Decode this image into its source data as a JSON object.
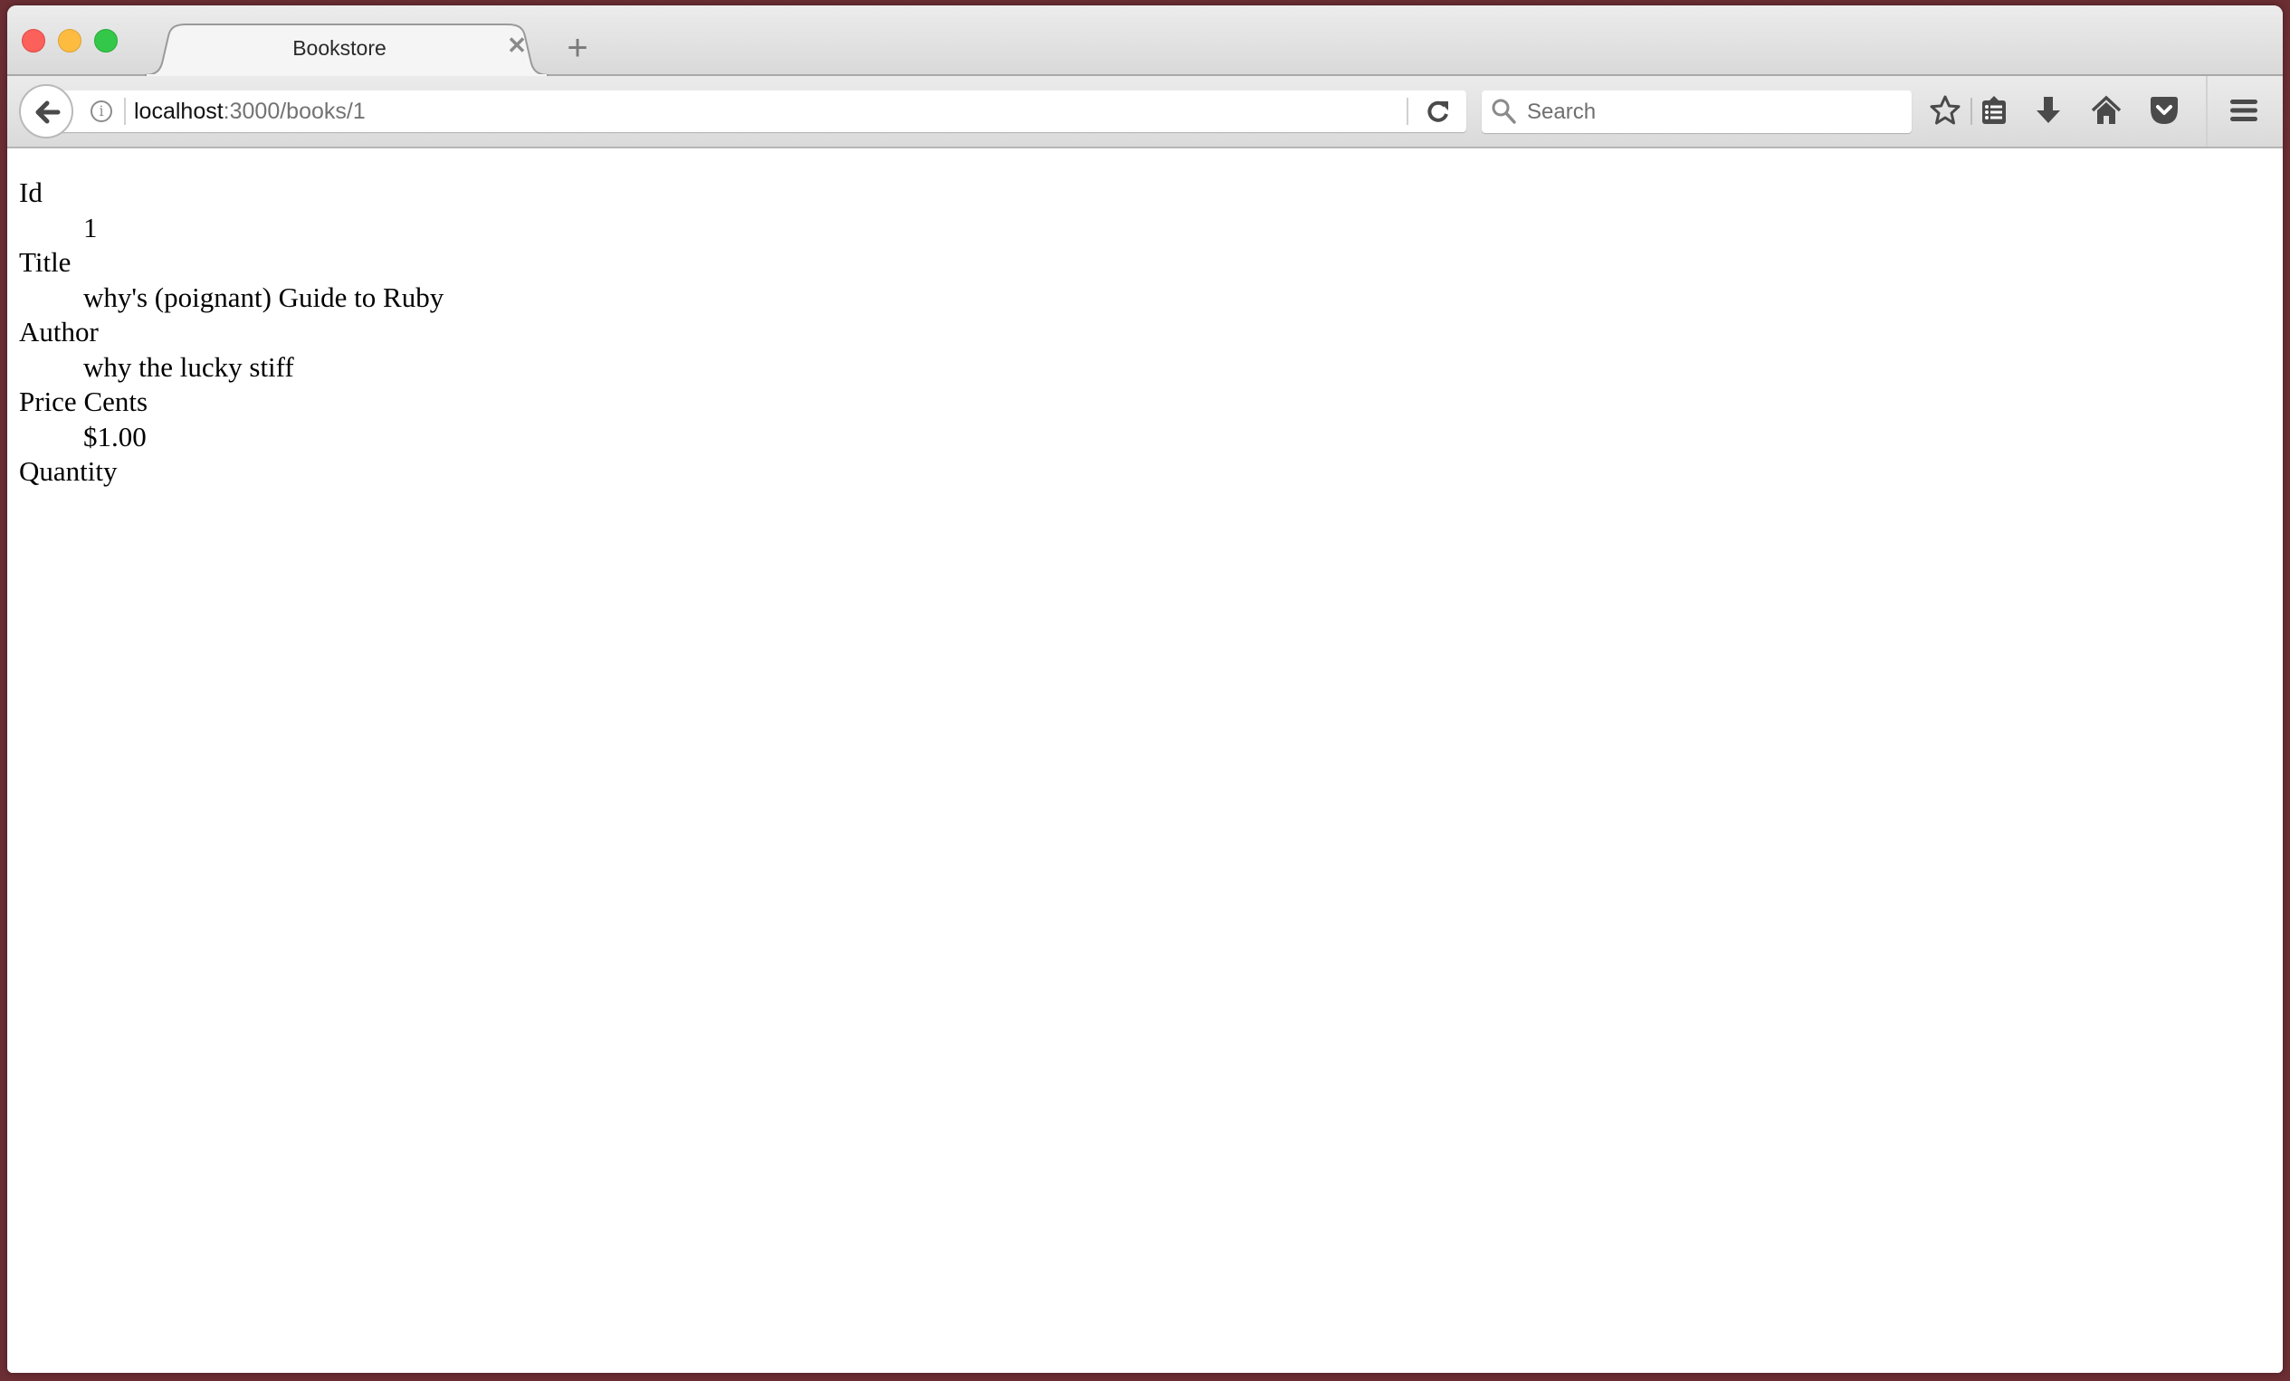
{
  "window": {
    "controls": [
      "close",
      "minimize",
      "zoom"
    ]
  },
  "tabs": [
    {
      "title": "Bookstore",
      "active": true,
      "close_glyph": "✕"
    }
  ],
  "new_tab_glyph": "+",
  "navbar": {
    "url_host": "localhost",
    "url_path": ":3000/books/1",
    "search_placeholder": "Search",
    "icons": [
      "back-icon",
      "info-icon",
      "reload-icon",
      "search-icon",
      "bookmark-star-icon",
      "reading-list-icon",
      "download-icon",
      "home-icon",
      "pocket-icon",
      "menu-icon"
    ]
  },
  "book": {
    "fields": [
      {
        "label": "Id",
        "value": "1"
      },
      {
        "label": "Title",
        "value": "why's (poignant) Guide to Ruby"
      },
      {
        "label": "Author",
        "value": "why the lucky stiff"
      },
      {
        "label": "Price Cents",
        "value": "$1.00"
      },
      {
        "label": "Quantity",
        "value": ""
      }
    ]
  },
  "colors": {
    "desktop": "#6b2e33",
    "traffic_red": "#fc605b",
    "traffic_yellow": "#fdbc40",
    "traffic_green": "#34c84a",
    "icon_gray": "#4a4a4a"
  }
}
